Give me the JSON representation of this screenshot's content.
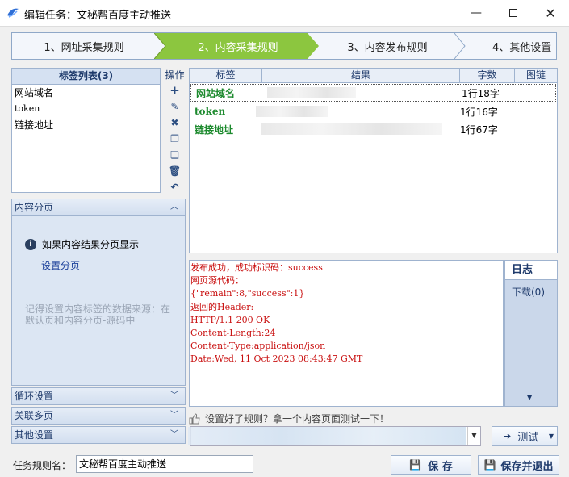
{
  "window": {
    "title": "编辑任务：文秘帮百度主动推送"
  },
  "steps": [
    {
      "label": "1、网址采集规则"
    },
    {
      "label": "2、内容采集规则"
    },
    {
      "label": "3、内容发布规则"
    },
    {
      "label": "4、其他设置"
    }
  ],
  "tags": {
    "header": "标签列表(3)",
    "items": [
      "网站域名",
      "token",
      "链接地址"
    ]
  },
  "ops": {
    "label": "操作"
  },
  "pagination": {
    "title": "内容分页",
    "info": "如果内容结果分页显示",
    "link": "设置分页",
    "hint": "记得设置内容标签的数据来源：在默认页和内容分页-源码中"
  },
  "sections": {
    "loop": "循环设置",
    "multi_page": "关联多页",
    "other": "其他设置"
  },
  "grid": {
    "headers": [
      "标签",
      "结果",
      "字数",
      "图链"
    ],
    "rows": [
      {
        "tag": "网站域名",
        "count": "1行18字"
      },
      {
        "tag": "token",
        "count": "1行16字"
      },
      {
        "tag": "链接地址",
        "count": "1行67字"
      }
    ]
  },
  "log": {
    "lines": [
      "发布成功，成功标识码：success",
      "网页源代码：",
      "{\"remain\":8,\"success\":1}",
      "返回的Header:",
      "HTTP/1.1 200 OK",
      "Content-Length:24",
      "Content-Type:application/json",
      "Date:Wed, 11 Oct 2023 08:43:47 GMT"
    ],
    "tab": "日志",
    "download": "下载(0)"
  },
  "test": {
    "tip": "设置好了规则？拿一个内容页面测试一下！",
    "button": "测试"
  },
  "footer": {
    "name_label": "任务规则名：",
    "name_value": "文秘帮百度主动推送",
    "save": "保 存",
    "save_exit": "保存并退出"
  },
  "colors": {
    "step_active": "#8cc63f",
    "log_text": "#c91010",
    "tag_text": "#1d8a2e"
  }
}
